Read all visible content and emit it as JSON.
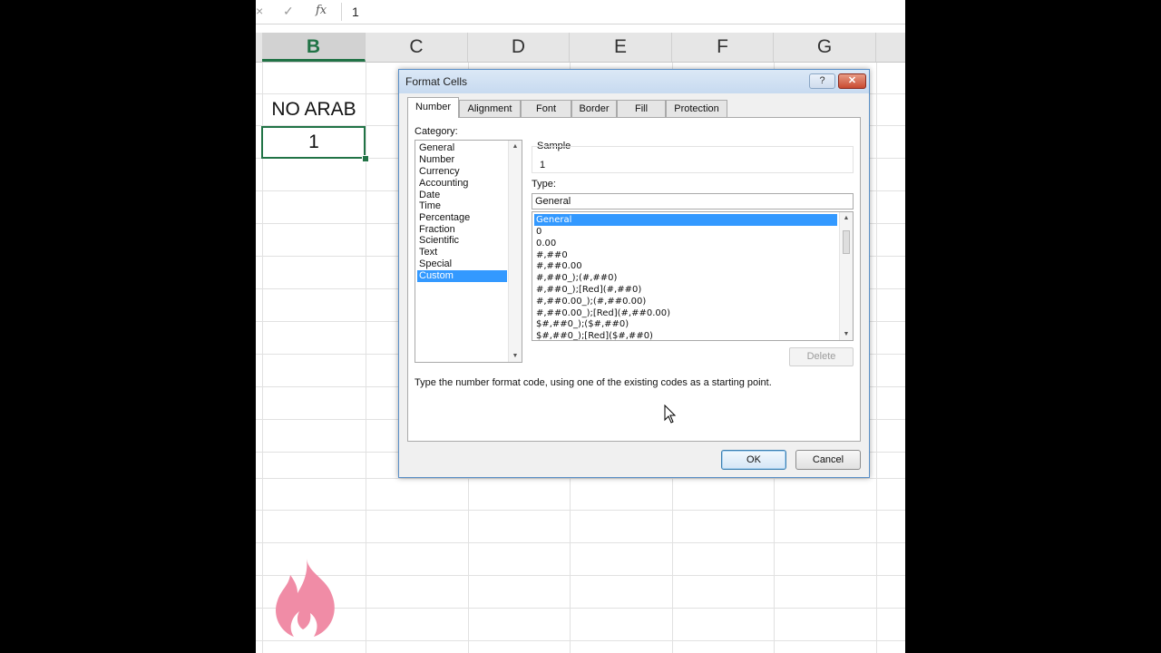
{
  "formula_bar": {
    "cancel_icon": "×",
    "enter_icon": "✓",
    "function_icon": "fx",
    "content": "1"
  },
  "columns": [
    {
      "label": "B",
      "active": true
    },
    {
      "label": "C",
      "active": false
    },
    {
      "label": "D",
      "active": false
    },
    {
      "label": "E",
      "active": false
    },
    {
      "label": "F",
      "active": false
    },
    {
      "label": "G",
      "active": false
    }
  ],
  "cells": {
    "b2": "NO ARAB",
    "b3": "1"
  },
  "dialog": {
    "title": "Format Cells",
    "help_label": "?",
    "close_label": "✕",
    "tabs": [
      "Number",
      "Alignment",
      "Font",
      "Border",
      "Fill",
      "Protection"
    ],
    "active_tab": "Number",
    "category_label": "Category:",
    "categories": [
      "General",
      "Number",
      "Currency",
      "Accounting",
      "Date",
      "Time",
      "Percentage",
      "Fraction",
      "Scientific",
      "Text",
      "Special",
      "Custom"
    ],
    "selected_category": "Custom",
    "sample_label": "Sample",
    "sample_value": "1",
    "type_label": "Type:",
    "type_value": "General",
    "type_options": [
      "General",
      "0",
      "0.00",
      "#,##0",
      "#,##0.00",
      "#,##0_);(#,##0)",
      "#,##0_);[Red](#,##0)",
      "#,##0.00_);(#,##0.00)",
      "#,##0.00_);[Red](#,##0.00)",
      "$#,##0_);($#,##0)",
      "$#,##0_);[Red]($#,##0)"
    ],
    "selected_type": "General",
    "delete_label": "Delete",
    "hint": "Type the number format code, using one of the existing codes as a starting point.",
    "ok_label": "OK",
    "cancel_label": "Cancel"
  },
  "colors": {
    "excel_green": "#217346",
    "selection_blue": "#3399ff",
    "logo_pink": "#f08ca6"
  }
}
